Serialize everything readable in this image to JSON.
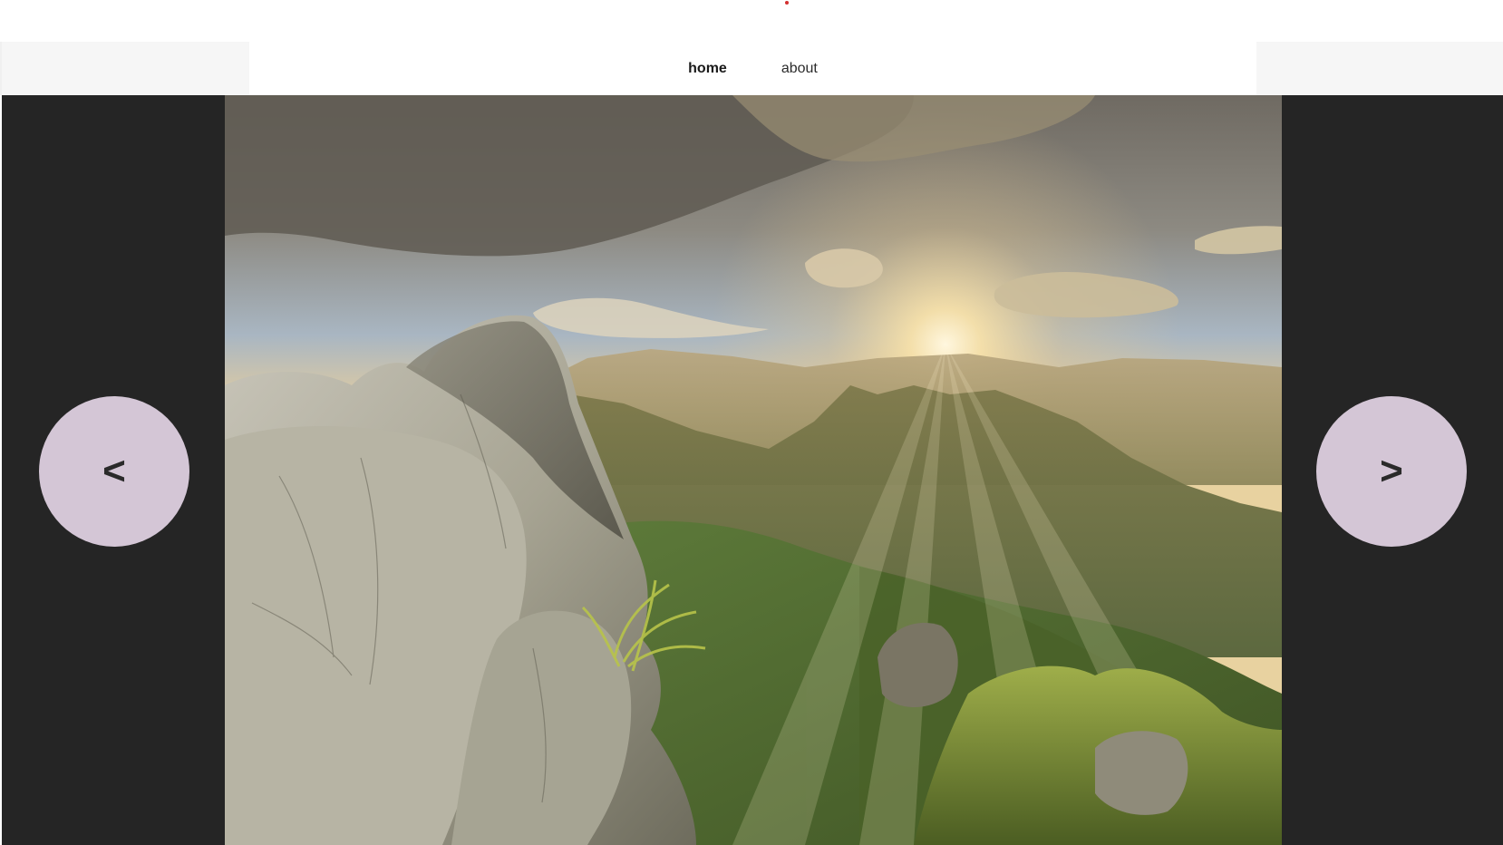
{
  "nav": {
    "links": [
      {
        "label": "home",
        "active": true
      },
      {
        "label": "about",
        "active": false
      }
    ]
  },
  "slider": {
    "prev_label": "<",
    "next_label": ">",
    "image_subject": "mountain-sunset-landscape"
  },
  "colors": {
    "slider_background": "#252525",
    "arrow_button": "#d4c6d6",
    "nav_side_panel": "#f6f6f6"
  }
}
